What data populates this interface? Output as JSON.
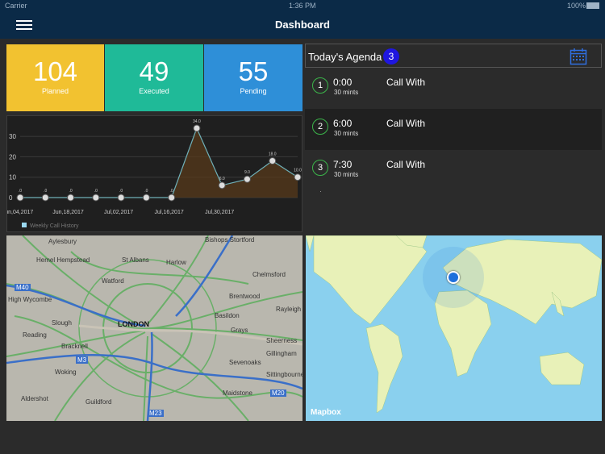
{
  "status_bar": {
    "carrier": "Carrier",
    "time": "1:36 PM",
    "battery": "100%"
  },
  "nav": {
    "title": "Dashboard",
    "menu_icon": "hamburger-menu-icon"
  },
  "stats": [
    {
      "value": "104",
      "label": "Planned",
      "color": "#f2c230"
    },
    {
      "value": "49",
      "label": "Executed",
      "color": "#1fba98"
    },
    {
      "value": "55",
      "label": "Pending",
      "color": "#2e8fd8"
    }
  ],
  "chart_data": {
    "type": "line",
    "x": [
      "Jun,04,2017",
      "Jun,11,2017",
      "Jun,18,2017",
      "Jun,25,2017",
      "Jul,02,2017",
      "Jul,09,2017",
      "Jul,16,2017",
      "Jul,23,2017",
      "Jul,30,2017",
      "Aug,06,2017",
      "Aug,13,2017"
    ],
    "xticks": [
      "Jun,04,2017",
      "Jun,18,2017",
      "Jul,02,2017",
      "Jul,16,2017",
      "Jul,30,2017"
    ],
    "series": [
      {
        "name": "Weekly Call History",
        "values": [
          0,
          0,
          0,
          0,
          0,
          0,
          0,
          34.0,
          6.0,
          9.0,
          18.0,
          10.0
        ]
      }
    ],
    "yticks": [
      0,
      10,
      20,
      30
    ],
    "ylim": [
      0,
      34
    ],
    "point_labels": [
      ".0",
      ".0",
      ".0",
      ".0",
      ".0",
      ".0",
      ".0",
      "34.0",
      "6.0",
      "9.0",
      "18.0",
      "10.0"
    ],
    "colors": {
      "line": "#6fb0b8",
      "fill": "#5a3a1a"
    }
  },
  "agenda": {
    "title": "Today's Agenda",
    "count": "3",
    "calendar_icon": "calendar-icon",
    "items": [
      {
        "num": "1",
        "time": "0:00",
        "duration": "30 mints",
        "title": "Call With"
      },
      {
        "num": "2",
        "time": "6:00",
        "duration": "30 mints",
        "title": "Call With"
      },
      {
        "num": "3",
        "time": "7:30",
        "duration": "30 mints",
        "title": "Call With"
      }
    ]
  },
  "london_map": {
    "labels": [
      "Aylesbury",
      "Bishops Stortford",
      "Hemel Hempstead",
      "St Albans",
      "Harlow",
      "Chelmsford",
      "Watford",
      "Brentwood",
      "High Wycombe",
      "Basildon",
      "Rayleigh",
      "Slough",
      "LONDON",
      "Grays",
      "Reading",
      "Bracknell",
      "Sheerness",
      "Gillingham",
      "Woking",
      "Sevenoaks",
      "Sittingbourne",
      "Aldershot",
      "Guildford",
      "Maidstone",
      "M40",
      "M3",
      "M20",
      "M23"
    ]
  },
  "world_map": {
    "attribution": "Mapbox"
  }
}
